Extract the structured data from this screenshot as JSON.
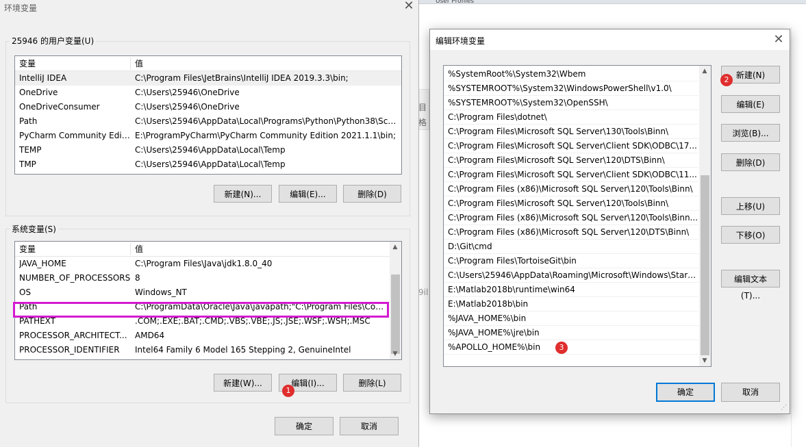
{
  "background": {
    "top_tab": "User Profiles",
    "frag_1": "目",
    "frag_2": "格",
    "frag_3": "9il"
  },
  "env_dialog": {
    "title": "环境变量",
    "close_glyph": "✕",
    "user_section": {
      "label": "25946 的用户变量(U)",
      "col_var": "变量",
      "col_val": "值",
      "rows": [
        {
          "var": "IntelliJ IDEA",
          "val": "C:\\Program Files\\JetBrains\\IntelliJ IDEA 2019.3.3\\bin;"
        },
        {
          "var": "OneDrive",
          "val": "C:\\Users\\25946\\OneDrive"
        },
        {
          "var": "OneDriveConsumer",
          "val": "C:\\Users\\25946\\OneDrive"
        },
        {
          "var": "Path",
          "val": "C:\\Users\\25946\\AppData\\Local\\Programs\\Python\\Python38\\Scri..."
        },
        {
          "var": "PyCharm Community Editi...",
          "val": "E:\\ProgramPyCharm\\PyCharm Community Edition 2021.1.1\\bin;"
        },
        {
          "var": "TEMP",
          "val": "C:\\Users\\25946\\AppData\\Local\\Temp"
        },
        {
          "var": "TMP",
          "val": "C:\\Users\\25946\\AppData\\Local\\Temp"
        }
      ],
      "btn_new": "新建(N)...",
      "btn_edit": "编辑(E)...",
      "btn_delete": "删除(D)"
    },
    "system_section": {
      "label": "系统变量(S)",
      "col_var": "变量",
      "col_val": "值",
      "rows": [
        {
          "var": "JAVA_HOME",
          "val": "C:\\Program Files\\Java\\jdk1.8.0_40"
        },
        {
          "var": "NUMBER_OF_PROCESSORS",
          "val": "8"
        },
        {
          "var": "OS",
          "val": "Windows_NT"
        },
        {
          "var": "Path",
          "val": "C:\\ProgramData\\Oracle\\Java\\javapath;\"C:\\Program Files\\Com..."
        },
        {
          "var": "PATHEXT",
          "val": ".COM;.EXE;.BAT;.CMD;.VBS;.VBE;.JS;.JSE;.WSF;.WSH;.MSC"
        },
        {
          "var": "PROCESSOR_ARCHITECT...",
          "val": "AMD64"
        },
        {
          "var": "PROCESSOR_IDENTIFIER",
          "val": "Intel64 Family 6 Model 165 Stepping 2, GenuineIntel"
        }
      ],
      "btn_new": "新建(W)...",
      "btn_edit": "编辑(I)...",
      "btn_delete": "删除(L)"
    },
    "btn_ok": "确定",
    "btn_cancel": "取消"
  },
  "edit_dialog": {
    "title": "编辑环境变量",
    "close_glyph": "✕",
    "items": [
      "%SystemRoot%\\System32\\Wbem",
      "%SYSTEMROOT%\\System32\\WindowsPowerShell\\v1.0\\",
      "%SYSTEMROOT%\\System32\\OpenSSH\\",
      "C:\\Program Files\\dotnet\\",
      "C:\\Program Files\\Microsoft SQL Server\\130\\Tools\\Binn\\",
      "C:\\Program Files\\Microsoft SQL Server\\Client SDK\\ODBC\\17...",
      "C:\\Program Files\\Microsoft SQL Server\\120\\DTS\\Binn\\",
      "C:\\Program Files\\Microsoft SQL Server\\Client SDK\\ODBC\\11...",
      "C:\\Program Files (x86)\\Microsoft SQL Server\\120\\Tools\\Binn\\",
      "C:\\Program Files\\Microsoft SQL Server\\120\\Tools\\Binn\\",
      "C:\\Program Files (x86)\\Microsoft SQL Server\\120\\Tools\\Binn...",
      "C:\\Program Files (x86)\\Microsoft SQL Server\\120\\DTS\\Binn\\",
      "D:\\Git\\cmd",
      "C:\\Program Files\\TortoiseGit\\bin",
      "C:\\Users\\25946\\AppData\\Roaming\\Microsoft\\Windows\\Start...",
      "E:\\Matlab2018b\\runtime\\win64",
      "E:\\Matlab2018b\\bin",
      "%JAVA_HOME%\\bin",
      "%JAVA_HOME%\\jre\\bin",
      "%APOLLO_HOME%\\bin"
    ],
    "btn_new": "新建(N)",
    "btn_edit": "编辑(E)",
    "btn_browse": "浏览(B)...",
    "btn_delete": "删除(D)",
    "btn_up": "上移(U)",
    "btn_down": "下移(O)",
    "btn_edit_text": "编辑文本(T)...",
    "btn_ok": "确定",
    "btn_cancel": "取消"
  },
  "annotations": {
    "badge_1": "1",
    "badge_2": "2",
    "badge_3": "3",
    "highlight_color": "#d41ad0",
    "badge_color": "#e02d2d"
  },
  "icons": {
    "scroll_up": "▲",
    "scroll_down": "▼",
    "resize_grip": "⋰"
  }
}
